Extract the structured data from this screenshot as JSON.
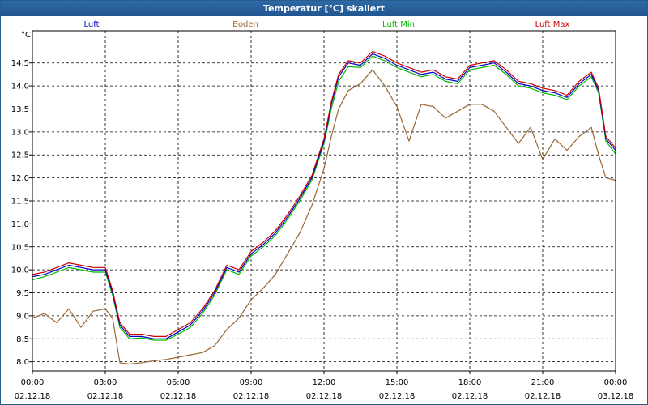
{
  "window": {
    "title": "Temperatur [°C] skaliert"
  },
  "chart_data": {
    "type": "line",
    "title": "Temperatur [°C] skaliert",
    "ylabel": "°C",
    "xlabel": "",
    "ylim": [
      7.8,
      15.2
    ],
    "xlim_hours": [
      0,
      24
    ],
    "grid": true,
    "legend_placement": "top",
    "yticks": [
      "8.0",
      "8.5",
      "9.0",
      "9.5",
      "10.0",
      "10.5",
      "11.0",
      "11.5",
      "12.0",
      "12.5",
      "13.0",
      "13.5",
      "14.0",
      "14.5"
    ],
    "xticks": [
      {
        "time": "00:00",
        "date": "02.12.18"
      },
      {
        "time": "03:00",
        "date": "02.12.18"
      },
      {
        "time": "06:00",
        "date": "02.12.18"
      },
      {
        "time": "09:00",
        "date": "02.12.18"
      },
      {
        "time": "12:00",
        "date": "02.12.18"
      },
      {
        "time": "15:00",
        "date": "02.12.18"
      },
      {
        "time": "18:00",
        "date": "02.12.18"
      },
      {
        "time": "21:00",
        "date": "02.12.18"
      },
      {
        "time": "00:00",
        "date": "03.12.18"
      }
    ],
    "x_hours": [
      0,
      0.5,
      1,
      1.5,
      2,
      2.5,
      3,
      3.3,
      3.6,
      4,
      4.5,
      5,
      5.5,
      6,
      6.5,
      7,
      7.5,
      8,
      8.5,
      9,
      9.5,
      10,
      10.5,
      11,
      11.5,
      12,
      12.3,
      12.6,
      13,
      13.5,
      14,
      14.5,
      15,
      15.5,
      16,
      16.5,
      17,
      17.5,
      18,
      18.5,
      19,
      19.5,
      20,
      20.5,
      21,
      21.5,
      22,
      22.5,
      23,
      23.3,
      23.6,
      24
    ],
    "series": [
      {
        "name": "Luft",
        "color": "#0000cc",
        "values": [
          9.85,
          9.9,
          10.0,
          10.1,
          10.05,
          10.0,
          10.0,
          9.5,
          8.8,
          8.55,
          8.55,
          8.5,
          8.5,
          8.65,
          8.8,
          9.1,
          9.5,
          10.05,
          9.95,
          10.35,
          10.55,
          10.8,
          11.15,
          11.55,
          12.0,
          12.8,
          13.6,
          14.2,
          14.5,
          14.45,
          14.7,
          14.6,
          14.45,
          14.35,
          14.25,
          14.3,
          14.15,
          14.1,
          14.4,
          14.45,
          14.5,
          14.3,
          14.05,
          14.0,
          13.9,
          13.85,
          13.75,
          14.05,
          14.25,
          13.9,
          12.85,
          12.6
        ]
      },
      {
        "name": "Boden",
        "color": "#996633",
        "values": [
          8.95,
          9.05,
          8.85,
          9.15,
          8.75,
          9.1,
          9.15,
          8.95,
          7.98,
          7.95,
          7.98,
          8.02,
          8.05,
          8.1,
          8.15,
          8.2,
          8.35,
          8.7,
          8.95,
          9.35,
          9.6,
          9.9,
          10.35,
          10.8,
          11.4,
          12.2,
          12.9,
          13.5,
          13.9,
          14.05,
          14.35,
          14.0,
          13.55,
          12.8,
          13.6,
          13.55,
          13.3,
          13.45,
          13.6,
          13.6,
          13.45,
          13.1,
          12.75,
          13.1,
          12.4,
          12.85,
          12.6,
          12.9,
          13.1,
          12.5,
          12.0,
          11.95
        ]
      },
      {
        "name": "Luft Min",
        "color": "#00bb00",
        "values": [
          9.78,
          9.85,
          9.95,
          10.05,
          10.0,
          9.95,
          9.95,
          9.45,
          8.75,
          8.5,
          8.52,
          8.47,
          8.47,
          8.6,
          8.75,
          9.05,
          9.45,
          10.0,
          9.9,
          10.3,
          10.5,
          10.75,
          11.1,
          11.5,
          11.95,
          12.75,
          13.5,
          14.1,
          14.42,
          14.4,
          14.65,
          14.55,
          14.4,
          14.3,
          14.2,
          14.25,
          14.1,
          14.05,
          14.35,
          14.4,
          14.45,
          14.25,
          14.0,
          13.95,
          13.85,
          13.8,
          13.7,
          14.0,
          14.2,
          13.85,
          12.8,
          12.52
        ]
      },
      {
        "name": "Luft Max",
        "color": "#cc0000",
        "values": [
          9.9,
          9.95,
          10.05,
          10.15,
          10.1,
          10.05,
          10.05,
          9.55,
          8.85,
          8.6,
          8.6,
          8.55,
          8.55,
          8.7,
          8.85,
          9.15,
          9.55,
          10.1,
          10.0,
          10.4,
          10.6,
          10.85,
          11.2,
          11.6,
          12.05,
          12.85,
          13.65,
          14.25,
          14.55,
          14.5,
          14.75,
          14.65,
          14.5,
          14.4,
          14.3,
          14.35,
          14.2,
          14.15,
          14.45,
          14.5,
          14.55,
          14.35,
          14.1,
          14.05,
          13.95,
          13.9,
          13.8,
          14.1,
          14.3,
          13.95,
          12.9,
          12.65
        ]
      }
    ]
  }
}
